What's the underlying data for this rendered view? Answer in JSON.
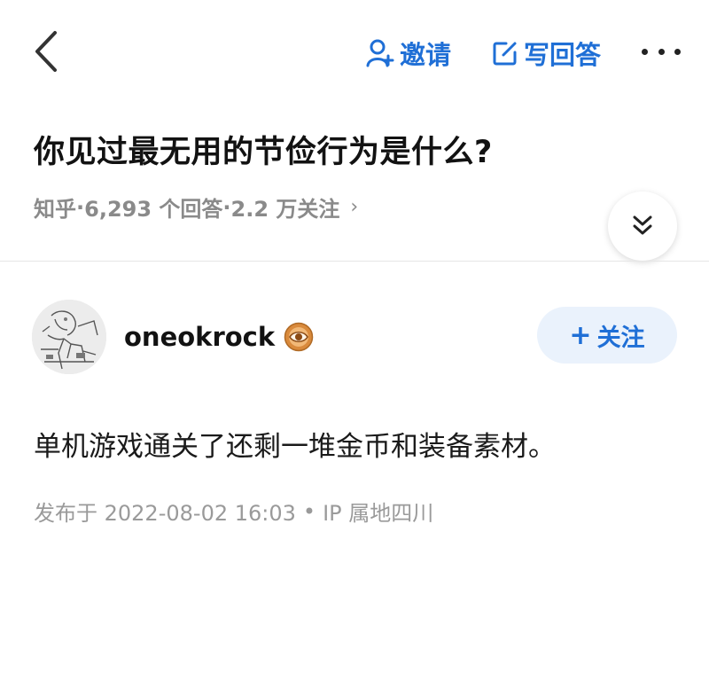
{
  "topbar": {
    "back_icon": "chevron-left-icon",
    "invite": {
      "icon": "person-plus-icon",
      "label": "邀请"
    },
    "write_answer": {
      "icon": "edit-square-icon",
      "label": "写回答"
    },
    "more_icon": "more-horizontal-icon"
  },
  "question": {
    "title": "你见过最无用的节俭行为是什么?",
    "meta": {
      "source": "知乎",
      "sep1": "·",
      "answers": "6,293 个回答",
      "sep2": "·",
      "followers": "2.2 万关注",
      "arrow": "›"
    },
    "collapse_icon": "double-chevron-down-icon"
  },
  "answer": {
    "author": {
      "name": "oneokrock",
      "badge_icon": "eye-badge-icon",
      "follow_label": "关注",
      "follow_plus": "+"
    },
    "content": "单机游戏通关了还剩一堆金币和装备素材。",
    "published": "发布于 2022-08-02 16:03",
    "dot": "•",
    "ip": "IP 属地四川"
  },
  "colors": {
    "accent": "#1f6fd6",
    "follow_bg": "#eaf2fc",
    "muted": "#8a8a8a",
    "badge": "#d98a3c"
  }
}
